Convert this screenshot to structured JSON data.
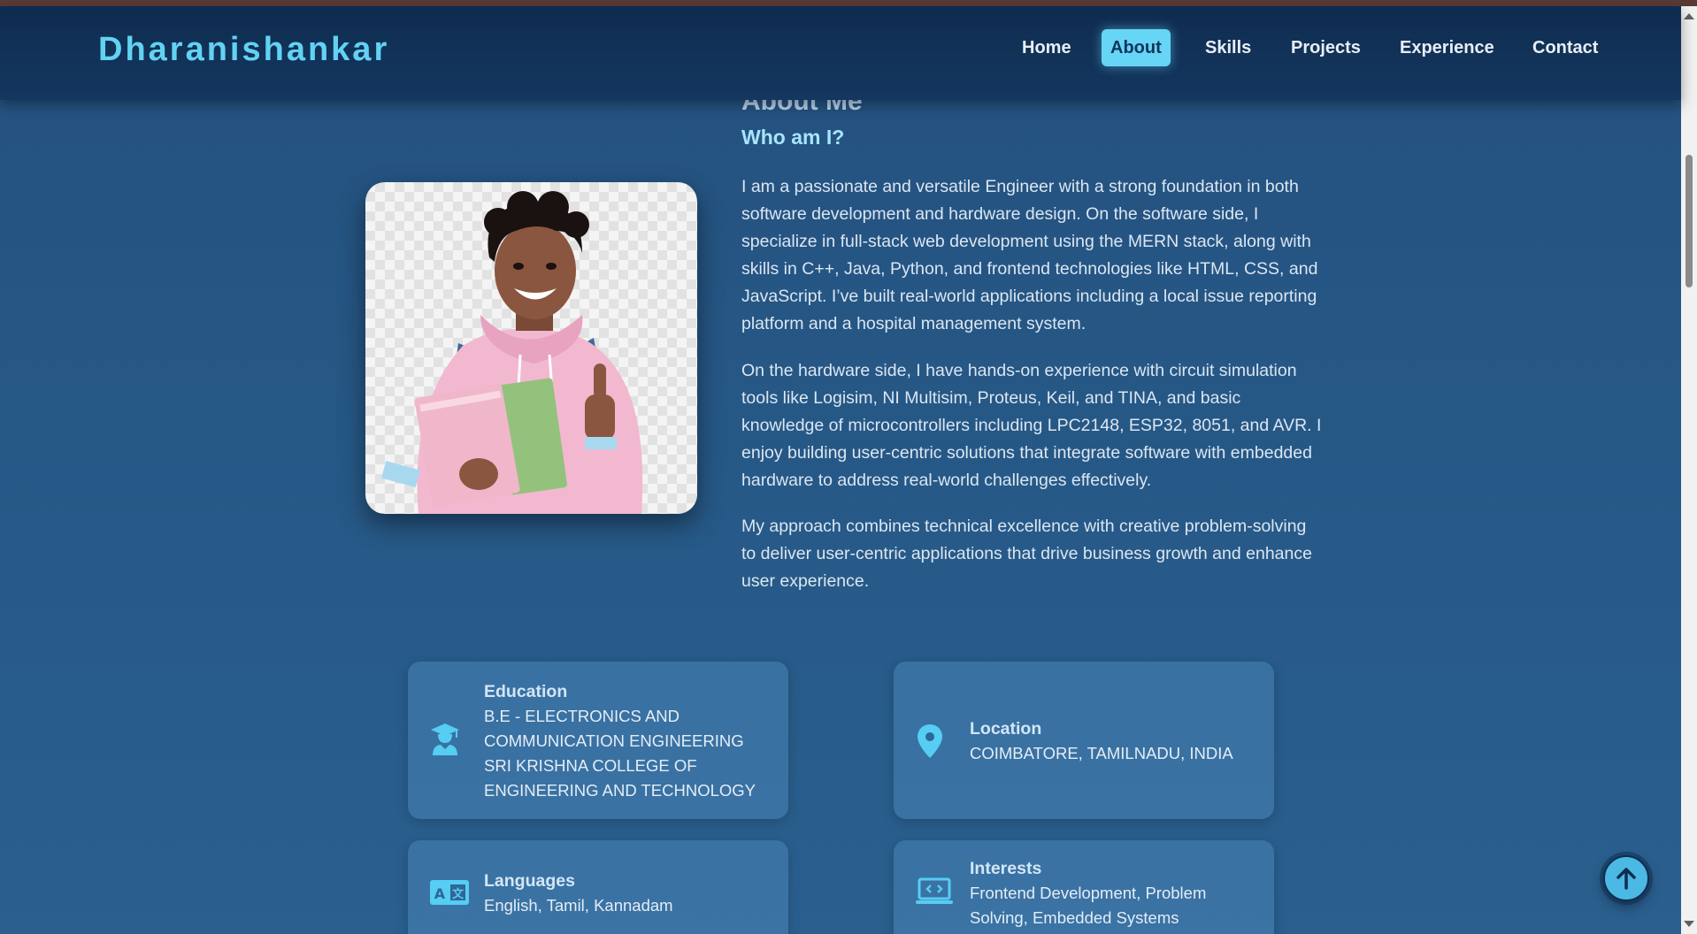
{
  "brand": "Dharanishankar",
  "nav": {
    "home": "Home",
    "about": "About",
    "skills": "Skills",
    "projects": "Projects",
    "experience": "Experience",
    "contact": "Contact",
    "active": "About"
  },
  "about": {
    "title": "About Me",
    "subtitle": "Who am I?",
    "photo_icon": "profile-photo",
    "paragraphs": [
      "I am a passionate and versatile Engineer with a strong foundation in both software development and hardware design. On the software side, I specialize in full-stack web development using the MERN stack, along with skills in C++, Java, Python, and frontend technologies like HTML, CSS, and JavaScript. I’ve built real-world applications including a local issue reporting platform and a hospital management system.",
      "On the hardware side, I have hands-on experience with circuit simulation tools like Logisim, NI Multisim, Proteus, Keil, and TINA, and basic knowledge of microcontrollers including LPC2148, ESP32, 8051, and AVR. I enjoy building user-centric solutions that integrate software with embedded hardware to address real-world challenges effectively.",
      "My approach combines technical excellence with creative problem-solving to deliver user-centric applications that drive business growth and enhance user experience."
    ]
  },
  "info": {
    "education": {
      "icon": "graduate-icon",
      "title": "Education",
      "lines": [
        "B.E - ELECTRONICS AND",
        "COMMUNICATION ENGINEERING",
        "SRI KRISHNA COLLEGE OF",
        "ENGINEERING AND TECHNOLOGY"
      ]
    },
    "location": {
      "icon": "location-pin-icon",
      "title": "Location",
      "value": "COIMBATORE, TAMILNADU, INDIA"
    },
    "languages": {
      "icon": "translate-icon",
      "title": "Languages",
      "value": "English, Tamil, Kannadam"
    },
    "interests": {
      "icon": "laptop-code-icon",
      "title": "Interests",
      "lines": [
        "Frontend Development, Problem",
        "Solving, Embedded Systems"
      ]
    }
  },
  "back_to_top_icon": "arrow-up-icon",
  "colors": {
    "accent": "#62d2f2",
    "nav_active_bg": "#67d5f5",
    "navbar_bg": "#0f2c4f",
    "page_bg": "#265886"
  }
}
